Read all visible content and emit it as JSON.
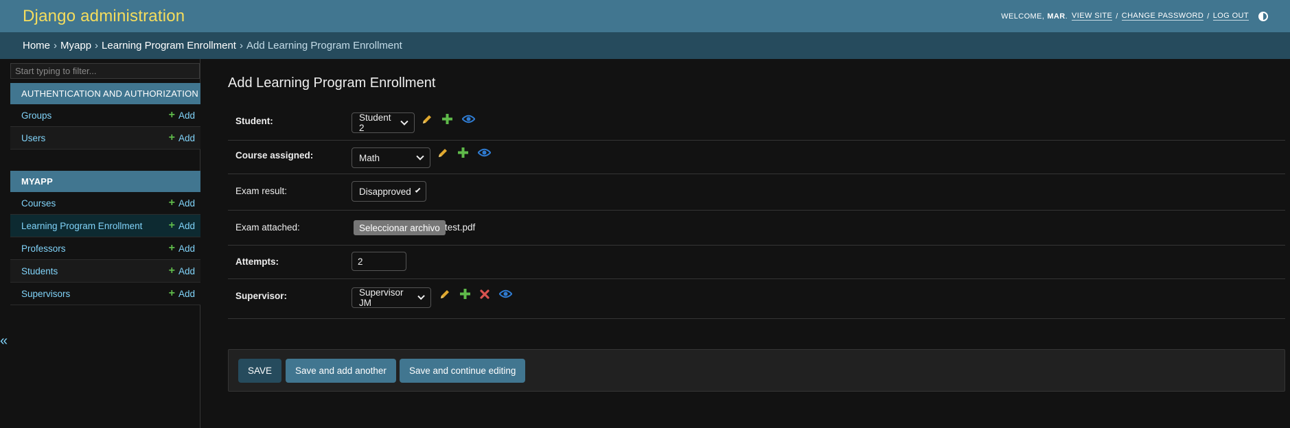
{
  "header": {
    "branding": "Django administration",
    "welcome": "Welcome,",
    "user": "mar",
    "user_suffix": ".",
    "view_site": "View site",
    "change_password": "Change password",
    "log_out": "Log out",
    "separator": "/"
  },
  "breadcrumbs": {
    "home": "Home",
    "app": "Myapp",
    "model": "Learning Program Enrollment",
    "current": "Add Learning Program Enrollment",
    "separator": "›"
  },
  "sidebar": {
    "filter_placeholder": "Start typing to filter...",
    "modules": [
      {
        "caption": "Authentication and Authorization",
        "models": [
          {
            "name": "Groups",
            "add": "Add"
          },
          {
            "name": "Users",
            "add": "Add"
          }
        ]
      },
      {
        "caption": "Myapp",
        "models": [
          {
            "name": "Courses",
            "add": "Add"
          },
          {
            "name": "Learning Program Enrollment",
            "add": "Add",
            "selected": true
          },
          {
            "name": "Professors",
            "add": "Add"
          },
          {
            "name": "Students",
            "add": "Add"
          },
          {
            "name": "Supervisors",
            "add": "Add"
          }
        ]
      }
    ],
    "toggle": "«"
  },
  "content": {
    "title": "Add Learning Program Enrollment",
    "fields": {
      "student": {
        "label": "Student:",
        "value": "Student 2"
      },
      "course": {
        "label": "Course assigned:",
        "value": "Math"
      },
      "exam_result": {
        "label": "Exam result:",
        "value": "Disapproved"
      },
      "exam_attached": {
        "label": "Exam attached:",
        "button": "Seleccionar archivo",
        "file": "test.pdf"
      },
      "attempts": {
        "label": "Attempts:",
        "value": "2"
      },
      "supervisor": {
        "label": "Supervisor:",
        "value": "Supervisor JM"
      }
    },
    "submit": {
      "save": "SAVE",
      "save_add": "Save and add another",
      "save_continue": "Save and continue editing"
    }
  },
  "colors": {
    "header_bg": "#417690",
    "breadcrumb_bg": "#264b5d",
    "branding": "#f5dd5d",
    "link": "#81d4fa",
    "add_plus": "#5fba4a",
    "pencil": "#e0a82e",
    "delete": "#d9534f",
    "view": "#2f7bd1"
  },
  "icons": [
    "pencil-icon",
    "plus-icon",
    "eye-icon",
    "x-icon",
    "theme-toggle-icon"
  ]
}
